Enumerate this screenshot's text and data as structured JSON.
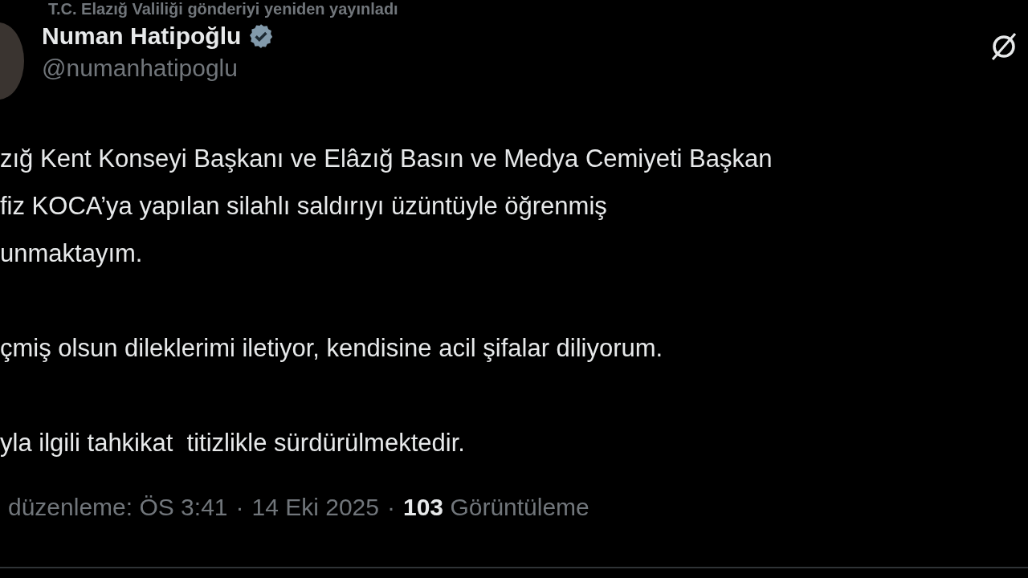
{
  "repost_note": "T.C. Elazığ Valiliği gönderiyi yeniden yayınladı",
  "author": {
    "name": "Numan Hatipoğlu",
    "verified": true,
    "handle": "@numanhatipoglu"
  },
  "body": [
    {
      "lines": [
        "zığ Kent Konseyi Başkanı ve Elâzığ Basın ve Medya Cemiyeti Başkan",
        "fiz KOCA’ya yapılan silahlı saldırıyı üzüntüyle öğrenmiş",
        "unmaktayım."
      ]
    },
    {
      "lines": [
        "çmiş olsun dileklerimi iletiyor, kendisine acil şifalar diliyorum."
      ]
    },
    {
      "lines": [
        "yla ilgili tahkikat  titizlikle sürdürülmektedir."
      ]
    }
  ],
  "footer": {
    "separator": "·",
    "edited": "düzenleme: ÖS 3:41",
    "date": "14 Eki 2025",
    "views_count": "103",
    "views_label": "Görüntüleme"
  }
}
